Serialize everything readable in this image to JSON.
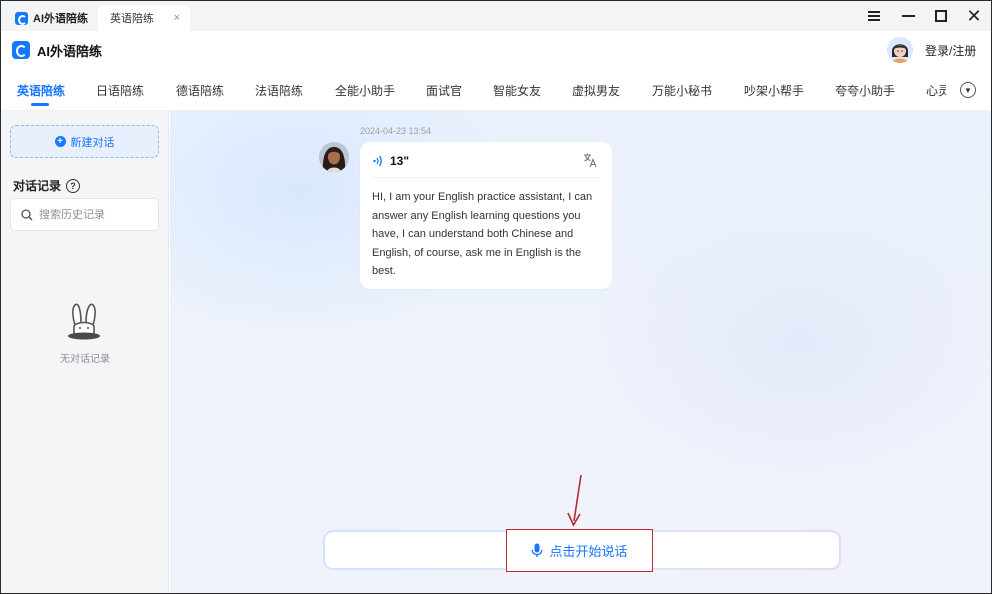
{
  "tabs": [
    {
      "label": "AI外语陪练"
    },
    {
      "label": "英语陪练",
      "close": "×"
    }
  ],
  "app": {
    "name": "AI外语陪练",
    "login_label": "登录/注册"
  },
  "categories": [
    {
      "label": "英语陪练",
      "active": true
    },
    {
      "label": "日语陪练"
    },
    {
      "label": "德语陪练"
    },
    {
      "label": "法语陪练"
    },
    {
      "label": "全能小助手"
    },
    {
      "label": "面试官"
    },
    {
      "label": "智能女友"
    },
    {
      "label": "虚拟男友"
    },
    {
      "label": "万能小秘书"
    },
    {
      "label": "吵架小帮手"
    },
    {
      "label": "夸夸小助手"
    },
    {
      "label": "心灵"
    }
  ],
  "sidebar": {
    "new_chat_label": "新建对话",
    "history_title": "对话记录",
    "search_placeholder": "搜索历史记录",
    "empty_text": "无对话记录"
  },
  "chat": {
    "timestamp": "2024-04-23 13:54",
    "voice_duration": "13\"",
    "message": "HI, I am your English practice assistant, I can answer any English learning questions you have, I can understand both Chinese and English, of course, ask me in English is the best."
  },
  "speak_button_label": "点击开始说话",
  "colors": {
    "accent": "#1677ff",
    "highlight_border": "#c0282b"
  },
  "icons": [
    "hamburger-menu-icon",
    "minimize-icon",
    "maximize-icon",
    "close-icon",
    "plus-circle-icon",
    "help-icon",
    "search-icon",
    "rabbit-icon",
    "sound-wave-icon",
    "translate-icon",
    "microphone-icon",
    "arrow-icon",
    "chevron-down-icon"
  ]
}
